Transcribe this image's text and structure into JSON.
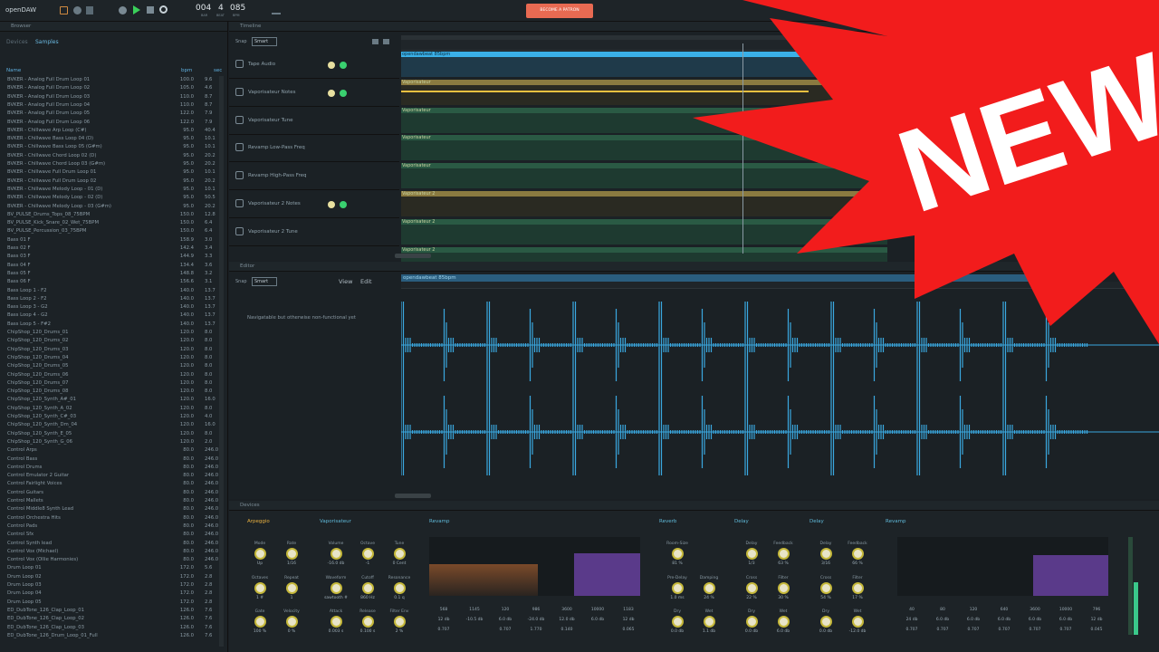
{
  "app": {
    "title": "openDAW",
    "position": {
      "bar": "004",
      "beat": "4",
      "bpm": "085",
      "bar_label": "BAR",
      "beat_label": "BEAT",
      "bpm_label": "BPM"
    },
    "patron_label": "BECOME A PATRON"
  },
  "browser": {
    "title": "Browser",
    "tabs": [
      "Devices",
      "Samples"
    ],
    "columns": {
      "name": "Name",
      "bpm": "bpm",
      "sec": "sec"
    },
    "items": [
      [
        "BVKER - Analog Full Drum Loop 01",
        "100.0",
        "9.6"
      ],
      [
        "BVKER - Analog Full Drum Loop 02",
        "105.0",
        "4.6"
      ],
      [
        "BVKER - Analog Full Drum Loop 03",
        "110.0",
        "8.7"
      ],
      [
        "BVKER - Analog Full Drum Loop 04",
        "110.0",
        "8.7"
      ],
      [
        "BVKER - Analog Full Drum Loop 05",
        "122.0",
        "7.9"
      ],
      [
        "BVKER - Analog Full Drum Loop 06",
        "122.0",
        "7.9"
      ],
      [
        "BVKER - Chillwave Arp Loop (C#)",
        "95.0",
        "40.4"
      ],
      [
        "BVKER - Chillwave Bass Loop 04 (D)",
        "95.0",
        "10.1"
      ],
      [
        "BVKER - Chillwave Bass Loop 05 (G#m)",
        "95.0",
        "10.1"
      ],
      [
        "BVKER - Chillwave Chord Loop 02 (D)",
        "95.0",
        "20.2"
      ],
      [
        "BVKER - Chillwave Chord Loop 03 (G#m)",
        "95.0",
        "20.2"
      ],
      [
        "BVKER - Chillwave Full Drum Loop 01",
        "95.0",
        "10.1"
      ],
      [
        "BVKER - Chillwave Full Drum Loop 02",
        "95.0",
        "20.2"
      ],
      [
        "BVKER - Chillwave Melody Loop - 01 (D)",
        "95.0",
        "10.1"
      ],
      [
        "BVKER - Chillwave Melody Loop - 02 (D)",
        "95.0",
        "50.5"
      ],
      [
        "BVKER - Chillwave Melody Loop - 03 (G#m)",
        "95.0",
        "20.2"
      ],
      [
        "BV_PULSE_Drums_Tops_08_75BPM",
        "150.0",
        "12.8"
      ],
      [
        "BV_PULSE_Kick_Snare_02_Wet_75BPM",
        "150.0",
        "6.4"
      ],
      [
        "BV_PULSE_Percussion_03_75BPM",
        "150.0",
        "6.4"
      ],
      [
        "Bass 01 F",
        "158.9",
        "3.0"
      ],
      [
        "Bass 02 F",
        "142.4",
        "3.4"
      ],
      [
        "Bass 03 F",
        "144.9",
        "3.3"
      ],
      [
        "Bass 04 F",
        "134.4",
        "3.6"
      ],
      [
        "Bass 05 F",
        "148.8",
        "3.2"
      ],
      [
        "Bass 06 F",
        "156.6",
        "3.1"
      ],
      [
        "Bass Loop 1 - F2",
        "140.0",
        "13.7"
      ],
      [
        "Bass Loop 2 - F2",
        "140.0",
        "13.7"
      ],
      [
        "Bass Loop 3 - G2",
        "140.0",
        "13.7"
      ],
      [
        "Bass Loop 4 - G2",
        "140.0",
        "13.7"
      ],
      [
        "Bass Loop 5 - F#2",
        "140.0",
        "13.7"
      ],
      [
        "ChipShop_120_Drums_01",
        "120.0",
        "8.0"
      ],
      [
        "ChipShop_120_Drums_02",
        "120.0",
        "8.0"
      ],
      [
        "ChipShop_120_Drums_03",
        "120.0",
        "8.0"
      ],
      [
        "ChipShop_120_Drums_04",
        "120.0",
        "8.0"
      ],
      [
        "ChipShop_120_Drums_05",
        "120.0",
        "8.0"
      ],
      [
        "ChipShop_120_Drums_06",
        "120.0",
        "8.0"
      ],
      [
        "ChipShop_120_Drums_07",
        "120.0",
        "8.0"
      ],
      [
        "ChipShop_120_Drums_08",
        "120.0",
        "8.0"
      ],
      [
        "ChipShop_120_Synth_A#_01",
        "120.0",
        "16.0"
      ],
      [
        "ChipShop_120_Synth_A_02",
        "120.0",
        "8.0"
      ],
      [
        "ChipShop_120_Synth_C#_03",
        "120.0",
        "4.0"
      ],
      [
        "ChipShop_120_Synth_Dm_04",
        "120.0",
        "16.0"
      ],
      [
        "ChipShop_120_Synth_E_05",
        "120.0",
        "8.0"
      ],
      [
        "ChipShop_120_Synth_G_06",
        "120.0",
        "2.0"
      ],
      [
        "Control Arps",
        "80.0",
        "246.0"
      ],
      [
        "Control Bass",
        "80.0",
        "246.0"
      ],
      [
        "Control Drums",
        "80.0",
        "246.0"
      ],
      [
        "Control Emulator 2 Guitar",
        "80.0",
        "246.0"
      ],
      [
        "Control Fairlight Voices",
        "80.0",
        "246.0"
      ],
      [
        "Control Guitars",
        "80.0",
        "246.0"
      ],
      [
        "Control Mallets",
        "80.0",
        "246.0"
      ],
      [
        "Control Middle8 Synth Lead",
        "80.0",
        "246.0"
      ],
      [
        "Control Orchestra Hits",
        "80.0",
        "246.0"
      ],
      [
        "Control Pads",
        "80.0",
        "246.0"
      ],
      [
        "Control Sfx",
        "80.0",
        "246.0"
      ],
      [
        "Control Synth lead",
        "80.0",
        "246.0"
      ],
      [
        "Control Vox (Michael)",
        "80.0",
        "246.0"
      ],
      [
        "Control Vox (Ollie Harmonies)",
        "80.0",
        "246.0"
      ],
      [
        "Drum Loop 01",
        "172.0",
        "5.6"
      ],
      [
        "Drum Loop 02",
        "172.0",
        "2.8"
      ],
      [
        "Drum Loop 03",
        "172.0",
        "2.8"
      ],
      [
        "Drum Loop 04",
        "172.0",
        "2.8"
      ],
      [
        "Drum Loop 05",
        "172.0",
        "2.8"
      ],
      [
        "ED_DubTone_126_Clap_Loop_01",
        "126.0",
        "7.6"
      ],
      [
        "ED_DubTone_126_Clap_Loop_02",
        "126.0",
        "7.6"
      ],
      [
        "ED_DubTone_126_Clap_Loop_03",
        "126.0",
        "7.6"
      ],
      [
        "ED_DubTone_126_Drum_Loop_01_Full",
        "126.0",
        "7.6"
      ]
    ]
  },
  "timeline": {
    "title": "Timeline",
    "snap_label": "Snap",
    "snap_value": "Smart",
    "tracks": [
      "Tape Audio",
      "Vaporisateur Notes",
      "Vaporisateur Tune",
      "Revamp Low-Pass Freq",
      "Revamp High-Pass Freq",
      "Vaporisateur 2 Notes",
      "Vaporisateur 2 Tune"
    ],
    "clips": [
      "opendawbeat 85bpm",
      "Vaporisateur",
      "Vaporisateur",
      "Vaporisateur",
      "Vaporisateur",
      "Vaporisateur 2",
      "Vaporisateur 2",
      "Vaporisateur 2"
    ]
  },
  "editor": {
    "title": "Editor",
    "snap_label": "Snap",
    "snap_value": "Smart",
    "view": "View",
    "edit": "Edit",
    "message": "Navigatable but otherwise non-functional yet",
    "clip": "opendawbeat 85bpm"
  },
  "devices": {
    "title": "Devices",
    "headers": [
      "Arpeggio",
      "Vaporisateur",
      "Revamp",
      "Reverb",
      "Delay",
      "Delay",
      "Revamp"
    ],
    "knobs": [
      [
        "Mode",
        "Up"
      ],
      [
        "Rate",
        "1/16"
      ],
      [
        "Octaves",
        "1 #"
      ],
      [
        "Repeat",
        "1"
      ],
      [
        "Gate",
        "100 %"
      ],
      [
        "Velocity",
        "0 %"
      ],
      [
        "Volume",
        "-16.0 db"
      ],
      [
        "Octave",
        "-1"
      ],
      [
        "Tune",
        "0 Cent"
      ],
      [
        "Waveform",
        "sawtooth #"
      ],
      [
        "Cutoff",
        "860 Hz"
      ],
      [
        "Resonance",
        "0.1 q"
      ],
      [
        "Attack",
        "0.003 s"
      ],
      [
        "Release",
        "0.100 s"
      ],
      [
        "Filter Env",
        "2 %"
      ],
      [
        "Room-Size",
        "81 %"
      ],
      [
        "Pre-Delay",
        "1.0 ms"
      ],
      [
        "Damping",
        "24 %"
      ],
      [
        "Dry",
        "0.0 db"
      ],
      [
        "Wet",
        "1.1 db"
      ],
      [
        "Delay",
        "1/3"
      ],
      [
        "Feedback",
        "63 %"
      ],
      [
        "Cross",
        "22 %"
      ],
      [
        "Filter",
        "30 %"
      ],
      [
        "Dry",
        "0.0 db"
      ],
      [
        "Wet",
        "6.0 db"
      ],
      [
        "Delay",
        "3/16"
      ],
      [
        "Feedback",
        "66 %"
      ],
      [
        "Cross",
        "54 %"
      ],
      [
        "Filter",
        "17 %"
      ],
      [
        "Dry",
        "0.0 db"
      ],
      [
        "Wet",
        "-12.0 db"
      ]
    ],
    "eq1": [
      [
        "568",
        "12 db",
        "0.707"
      ],
      [
        "1145",
        "-10.5 db",
        ""
      ],
      [
        "120",
        "6.0 db",
        "0.707"
      ],
      [
        "986",
        "-24.0 db",
        "1.770"
      ],
      [
        "3600",
        "12.0 db",
        "0.140"
      ],
      [
        "10000",
        "6.0 db",
        ""
      ],
      [
        "1183",
        "12 db",
        "0.065"
      ]
    ],
    "eq2": [
      [
        "40",
        "24 db",
        "0.707"
      ],
      [
        "80",
        "6.0 db",
        "0.707"
      ],
      [
        "120",
        "6.0 db",
        "0.707"
      ],
      [
        "640",
        "6.0 db",
        "0.707"
      ],
      [
        "3600",
        "6.0 db",
        "0.707"
      ],
      [
        "10000",
        "6.0 db",
        "0.707"
      ],
      [
        "796",
        "12 db",
        "0.045"
      ]
    ]
  },
  "overlay": {
    "text": "NEW",
    "color": "#f21c1c"
  }
}
